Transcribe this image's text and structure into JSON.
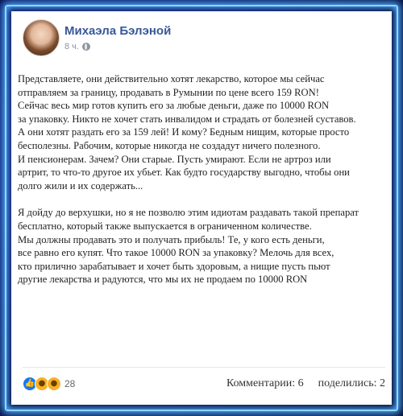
{
  "author": {
    "name": "Михаэла Бэлэной",
    "time": "8 ч."
  },
  "post": {
    "paragraph1": "Представляете, они действительно хотят лекарство, которое мы сейчас\nотправляем за границу, продавать в Румынии по цене всего 159 RON!\nСейчас весь мир готов купить его за любые деньги, даже по 10000 RON\nза упаковку. Никто не хочет стать инвалидом и страдать от болезней суставов.\nА они хотят раздать его за 159 лей! И кому? Бедным нищим, которые просто\nбесполезны. Рабочим, которые никогда не создадут ничего полезного.\nИ пенсионерам. Зачем? Они старые. Пусть умирают. Если не артроз или\nартрит, то что-то другое их убьет. Как будто государству выгодно, чтобы они\nдолго жили и их содержать...",
    "paragraph2": "Я дойду до верхушки, но я не позволю этим идиотам раздавать такой препарат\nбесплатно, который также выпускается в ограниченном количестве.\nМы должны продавать это и получать прибыль! Те, у кого есть деньги,\nвсе равно его купят. Что такое 10000 RON за упаковку? Мелочь для всех,\nкто прилично зарабатывает и хочет быть здоровым, а нищие пусть пьют\nдругие лекарства и радуются, что мы их не продаем по 10000 RON"
  },
  "footer": {
    "reactions_count": "28",
    "reaction_icons": [
      "like-icon",
      "wow-icon",
      "haha-icon"
    ],
    "comments": "Комментарии: 6",
    "shares": "поделились: 2"
  },
  "colors": {
    "author_name": "#385898",
    "frame_glow": "#4fb0ff",
    "like": "#1877f2"
  }
}
